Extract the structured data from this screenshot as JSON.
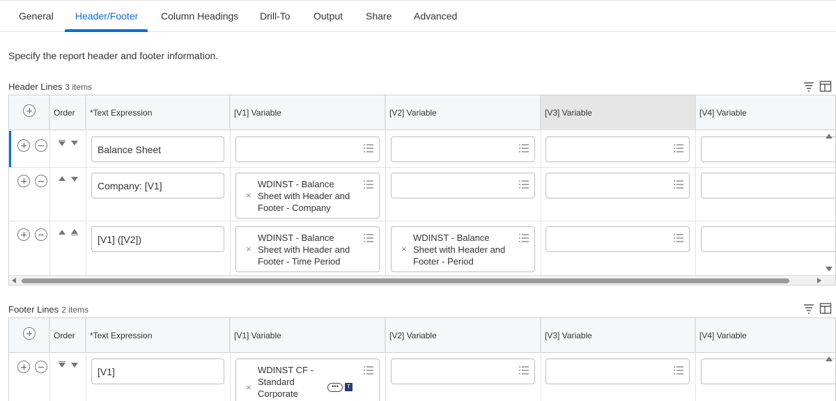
{
  "tabs": [
    "General",
    "Header/Footer",
    "Column Headings",
    "Drill-To",
    "Output",
    "Share",
    "Advanced"
  ],
  "active_tab": "Header/Footer",
  "intro_text": "Specify the report header and footer information.",
  "header_lines": {
    "title": "Header Lines",
    "count": "3 items",
    "columns": [
      "Order",
      "*Text Expression",
      "[V1] Variable",
      "[V2] Variable",
      "[V3] Variable",
      "[V4] Variable"
    ],
    "rows": [
      {
        "text_expression": "Balance Sheet",
        "v1": "",
        "v2": ""
      },
      {
        "text_expression": "Company: [V1]",
        "v1": "WDINST - Balance Sheet with Header and Footer - Company",
        "v2": ""
      },
      {
        "text_expression": "[V1] ([V2])",
        "v1": "WDINST - Balance Sheet with Header and Footer - Time Period",
        "v2": "WDINST - Balance Sheet with Header and Footer - Period"
      }
    ]
  },
  "footer_lines": {
    "title": "Footer Lines",
    "count": "2 items",
    "columns": [
      "Order",
      "*Text Expression",
      "[V1] Variable",
      "[V2] Variable",
      "[V3] Variable",
      "[V4] Variable"
    ],
    "rows": [
      {
        "text_expression": "[V1]",
        "v1": "WDINST CF - Standard Corporate",
        "badge_more": "•••",
        "badge_type": "T"
      }
    ]
  },
  "icons": {
    "filter": "filter-icon",
    "layout": "table-layout-icon",
    "list": "list-icon"
  },
  "colors": {
    "accent": "#0b6dd4"
  }
}
